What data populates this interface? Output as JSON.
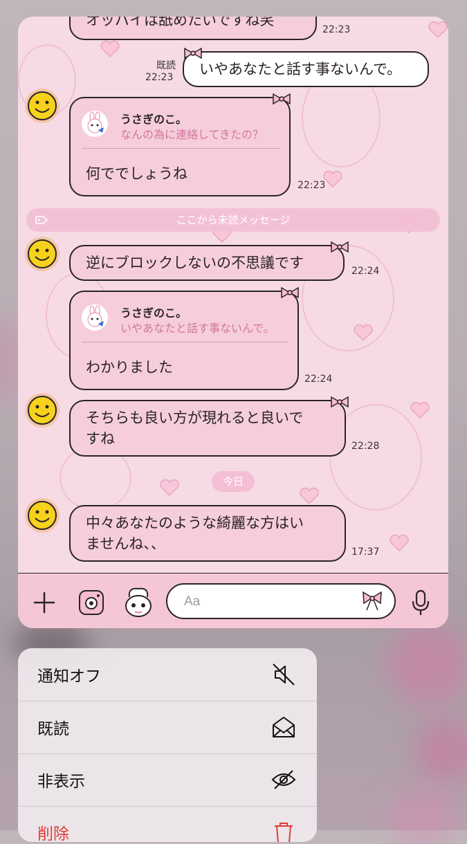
{
  "chat": {
    "top_partial": {
      "text": "オッパイは舐めたいですね笑",
      "time": "22:23"
    },
    "sent": {
      "text": "いやあなたと話す事ないんで。",
      "read_label": "既読",
      "time": "22:23"
    },
    "reply1": {
      "quoted_name": "うさぎのこ。",
      "quoted_text": "なんの為に連絡してきたの？",
      "text": "何ででしょうね",
      "time": "22:23"
    },
    "unread_divider": "ここから未読メッセージ",
    "msg2": {
      "text": "逆にブロックしないの不思議です",
      "time": "22:24"
    },
    "reply2": {
      "quoted_name": "うさぎのこ。",
      "quoted_text": "いやあなたと話す事ないんで。",
      "text": "わかりました",
      "time": "22:24"
    },
    "msg3": {
      "lines": [
        "そちらも良い方が現れると良いで",
        "すね"
      ],
      "time": "22:28"
    },
    "date_divider": "今日",
    "msg4": {
      "lines": [
        "中々あなたのような綺麗な方はい",
        "ませんね、、"
      ],
      "time": "17:37"
    }
  },
  "input": {
    "placeholder": "Aa"
  },
  "icons": {
    "add": "plus-icon",
    "camera": "camera-icon",
    "sticker": "sticker-icon",
    "emoji": "bow-emoji-icon",
    "mic": "microphone-icon"
  },
  "menu": {
    "items": [
      {
        "label": "通知オフ",
        "icon": "bell-off-icon"
      },
      {
        "label": "既読",
        "icon": "envelope-open-icon"
      },
      {
        "label": "非表示",
        "icon": "eye-off-icon"
      },
      {
        "label": "削除",
        "icon": "trash-icon",
        "color": "#e53935"
      }
    ]
  },
  "colors": {
    "bubble_pink": "#f6cddb",
    "chat_background": "#f6dbe5",
    "input_bar": "#f4c6d6",
    "quote_text": "#d0779c",
    "destructive": "#e53935"
  }
}
